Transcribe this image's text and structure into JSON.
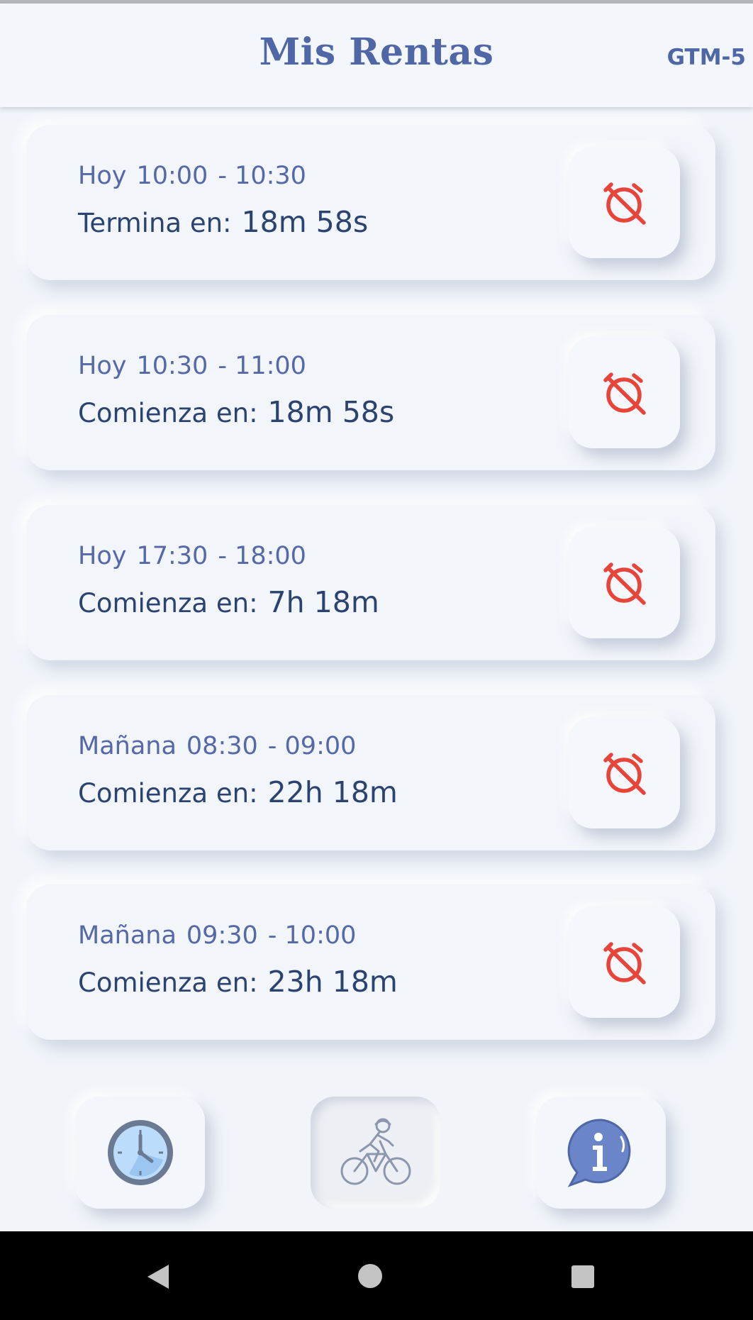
{
  "header": {
    "title": "Mis Rentas",
    "timezone": "GTM-5"
  },
  "rentals": [
    {
      "day": "Hoy",
      "start": "10:00",
      "end": "- 10:30",
      "status_label": "Termina en:",
      "remaining": "18m 58s"
    },
    {
      "day": "Hoy",
      "start": "10:30",
      "end": "- 11:00",
      "status_label": "Comienza en:",
      "remaining": "18m 58s"
    },
    {
      "day": "Hoy",
      "start": "17:30",
      "end": "- 18:00",
      "status_label": "Comienza en:",
      "remaining": "7h 18m"
    },
    {
      "day": "Mañana",
      "start": "08:30",
      "end": "- 09:00",
      "status_label": "Comienza en:",
      "remaining": "22h 18m"
    },
    {
      "day": "Mañana",
      "start": "09:30",
      "end": "- 10:00",
      "status_label": "Comienza en:",
      "remaining": "23h 18m"
    }
  ],
  "icons": {
    "cancel": "alarm-off-icon",
    "nav_schedule": "clock-icon",
    "nav_rentals": "cyclist-icon",
    "nav_info": "info-bubble-icon",
    "sys_back": "back-triangle-icon",
    "sys_home": "home-circle-icon",
    "sys_recents": "recents-square-icon"
  },
  "colors": {
    "accent": "#4f67a6",
    "danger": "#e8443a",
    "text_dark": "#2b4370",
    "background": "#f1f5fa"
  },
  "bottom_nav": {
    "active": "rentals"
  }
}
